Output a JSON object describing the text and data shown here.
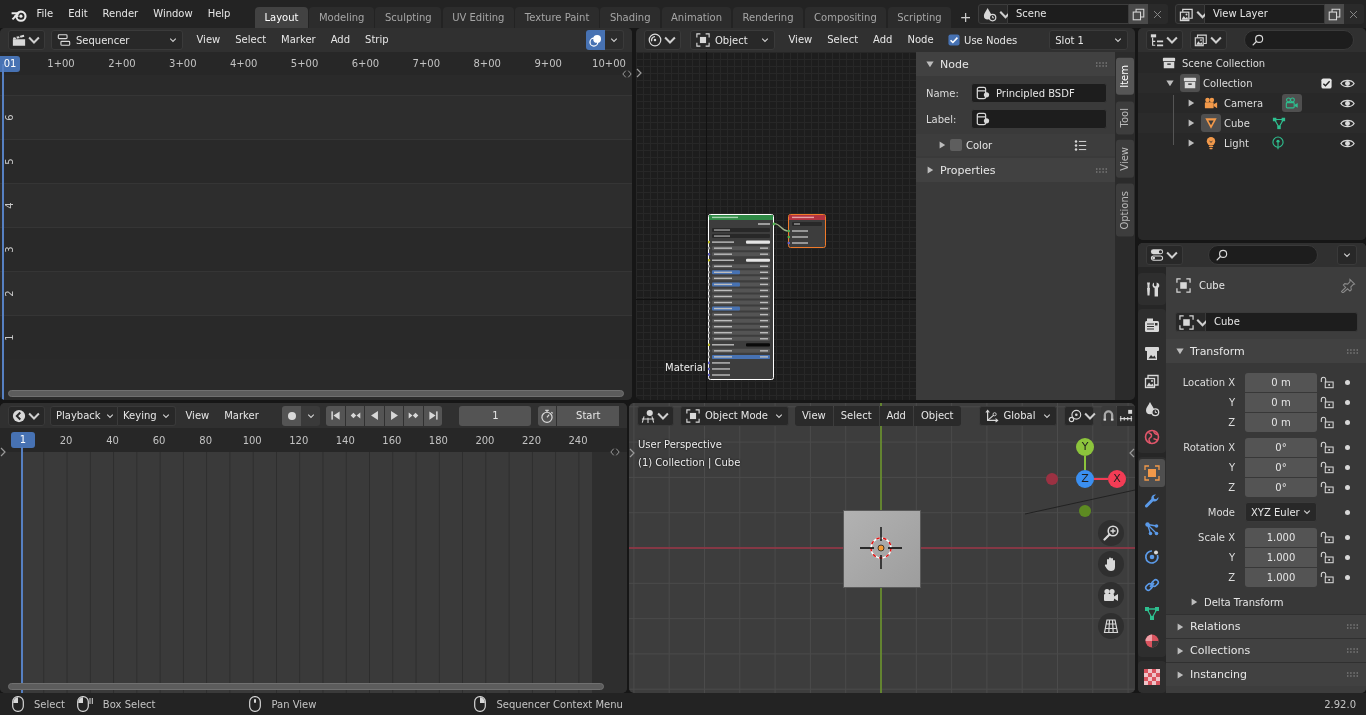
{
  "top_bar": {
    "menus": [
      "File",
      "Edit",
      "Render",
      "Window",
      "Help"
    ],
    "workspaces": [
      {
        "label": "Layout",
        "selected": true
      },
      {
        "label": "Modeling",
        "selected": false
      },
      {
        "label": "Sculpting",
        "selected": false
      },
      {
        "label": "UV Editing",
        "selected": false
      },
      {
        "label": "Texture Paint",
        "selected": false
      },
      {
        "label": "Shading",
        "selected": false
      },
      {
        "label": "Animation",
        "selected": false
      },
      {
        "label": "Rendering",
        "selected": false
      },
      {
        "label": "Compositing",
        "selected": false
      },
      {
        "label": "Scripting",
        "selected": false
      }
    ],
    "add_workspace": "+",
    "scene": "Scene",
    "view_layer": "View Layer"
  },
  "sequencer": {
    "editor": "Sequencer",
    "menus": [
      "View",
      "Select",
      "Marker",
      "Add",
      "Strip"
    ],
    "overlays": true,
    "current_frame": "01",
    "ruler": [
      "1+00",
      "2+00",
      "3+00",
      "4+00",
      "5+00",
      "6+00",
      "7+00",
      "8+00",
      "9+00",
      "10+00"
    ],
    "channels": [
      "6",
      "5",
      "4",
      "3",
      "2",
      "1"
    ]
  },
  "node_editor": {
    "shader_type": "Object",
    "menus": [
      "View",
      "Select",
      "Add",
      "Node"
    ],
    "use_nodes": {
      "label": "Use Nodes",
      "checked": true
    },
    "slot": "Slot 1",
    "material_label": "Material",
    "sidebar": {
      "node_panel": {
        "title": "Node",
        "expanded": true,
        "name_label": "Name:",
        "name_value": "Principled BSDF",
        "label_label": "Label:",
        "color": {
          "label": "Color",
          "expanded": false
        }
      },
      "properties_panel": {
        "title": "Properties",
        "expanded": false
      },
      "tabs": [
        {
          "label": "Item",
          "selected": true
        },
        {
          "label": "Tool",
          "selected": false
        },
        {
          "label": "View",
          "selected": false
        },
        {
          "label": "Options",
          "selected": false
        }
      ]
    }
  },
  "outliner": {
    "tree": [
      {
        "label": "Scene Collection",
        "kind": "scene_collection",
        "children": [
          {
            "label": "Collection",
            "kind": "collection",
            "expanded": true,
            "checked": true,
            "active": true,
            "children": [
              {
                "label": "Camera",
                "kind": "camera",
                "expanded": false,
                "active": false,
                "data_active": true
              },
              {
                "label": "Cube",
                "kind": "mesh",
                "expanded": false,
                "active": true,
                "data_active": false
              },
              {
                "label": "Light",
                "kind": "light",
                "expanded": false,
                "active": false,
                "data_active": false
              }
            ]
          }
        ]
      }
    ]
  },
  "properties": {
    "tab_groups": [
      [
        {
          "kind": "tool",
          "selected": false
        }
      ],
      [
        {
          "kind": "render",
          "selected": false
        },
        {
          "kind": "output",
          "selected": false
        },
        {
          "kind": "view_layer",
          "selected": false
        },
        {
          "kind": "scene",
          "selected": false
        },
        {
          "kind": "world",
          "selected": false
        }
      ],
      [
        {
          "kind": "object",
          "selected": true
        },
        {
          "kind": "modifiers",
          "selected": false
        },
        {
          "kind": "particles",
          "selected": false
        },
        {
          "kind": "physics",
          "selected": false
        },
        {
          "kind": "constraints",
          "selected": false
        },
        {
          "kind": "data",
          "selected": false
        },
        {
          "kind": "material",
          "selected": false
        }
      ],
      [
        {
          "kind": "texture",
          "selected": false
        }
      ]
    ],
    "context": "Cube",
    "object_name": "Cube",
    "transform": {
      "title": "Transform",
      "expanded": true,
      "groups": [
        [
          {
            "kind": "number",
            "label": "Location X",
            "value": "0 m"
          },
          {
            "kind": "number",
            "label": "Y",
            "value": "0 m"
          },
          {
            "kind": "number",
            "label": "Z",
            "value": "0 m"
          }
        ],
        [
          {
            "kind": "number",
            "label": "Rotation X",
            "value": "0°"
          },
          {
            "kind": "number",
            "label": "Y",
            "value": "0°"
          },
          {
            "kind": "number",
            "label": "Z",
            "value": "0°"
          }
        ],
        [
          {
            "kind": "dropdown",
            "label": "Mode",
            "value": "XYZ Euler"
          }
        ],
        [
          {
            "kind": "number",
            "label": "Scale X",
            "value": "1.000"
          },
          {
            "kind": "number",
            "label": "Y",
            "value": "1.000"
          },
          {
            "kind": "number",
            "label": "Z",
            "value": "1.000"
          }
        ]
      ],
      "subpanels": [
        {
          "title": "Delta Transform",
          "expanded": false
        }
      ]
    },
    "panels": [
      {
        "title": "Relations",
        "expanded": false
      },
      {
        "title": "Collections",
        "expanded": false
      },
      {
        "title": "Instancing",
        "expanded": false
      }
    ]
  },
  "timeline": {
    "menus": [
      {
        "label": "Playback",
        "kind": "dropdown"
      },
      {
        "label": "Keying",
        "kind": "dropdown"
      },
      {
        "label": "View",
        "kind": "menu"
      },
      {
        "label": "Marker",
        "kind": "menu"
      }
    ],
    "auto_keying": false,
    "current_frame": "1",
    "start_label": "Start",
    "ruler_current": "1",
    "ruler": [
      "20",
      "40",
      "60",
      "80",
      "100",
      "120",
      "140",
      "160",
      "180",
      "200",
      "220",
      "240"
    ]
  },
  "viewport": {
    "mode": "Object Mode",
    "menus": [
      "View",
      "Select",
      "Add",
      "Object"
    ],
    "orientation": "Global",
    "snap": false,
    "overlay_text": [
      "User Perspective",
      "(1) Collection | Cube"
    ],
    "gizmo": [
      {
        "label": "Y",
        "color": "#8cc43c"
      },
      {
        "label": "Z",
        "color": "#3b8ff0"
      },
      {
        "label": "X",
        "color": "#f33c55"
      }
    ]
  },
  "status_bar": {
    "hints": [
      {
        "label": "Select",
        "kind": "left"
      },
      {
        "label": "Box Select",
        "kind": "left_drag"
      },
      {
        "label": "Pan View",
        "kind": "middle"
      },
      {
        "label": "Sequencer Context Menu",
        "kind": "right"
      }
    ],
    "version": "2.92.0"
  }
}
